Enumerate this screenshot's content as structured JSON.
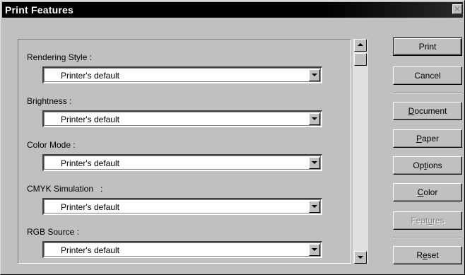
{
  "window": {
    "title": "Print Features",
    "close_glyph": "✕"
  },
  "fields": [
    {
      "label": "Rendering Style :",
      "value": "Printer's default"
    },
    {
      "label": "Brightness :",
      "value": "Printer's default"
    },
    {
      "label": "Color Mode :",
      "value": "Printer's default"
    },
    {
      "label": "CMYK Simulation   :",
      "value": "Printer's default"
    },
    {
      "label": "RGB Source :",
      "value": "Printer's default"
    }
  ],
  "buttons": {
    "print": "Print",
    "cancel": "Cancel",
    "document": {
      "pre": "",
      "key": "D",
      "post": "ocument"
    },
    "paper": {
      "pre": "",
      "key": "P",
      "post": "aper"
    },
    "options": {
      "pre": "Op",
      "key": "t",
      "post": "ions"
    },
    "color": {
      "pre": "",
      "key": "C",
      "post": "olor"
    },
    "features": {
      "pre": "Feat",
      "key": "u",
      "post": "res"
    },
    "reset": {
      "pre": "R",
      "key": "e",
      "post": "set"
    }
  },
  "icons": {
    "close": "close-icon",
    "dropdown": "chevron-down-icon",
    "scroll_up": "arrow-up-icon",
    "scroll_down": "arrow-down-icon"
  }
}
